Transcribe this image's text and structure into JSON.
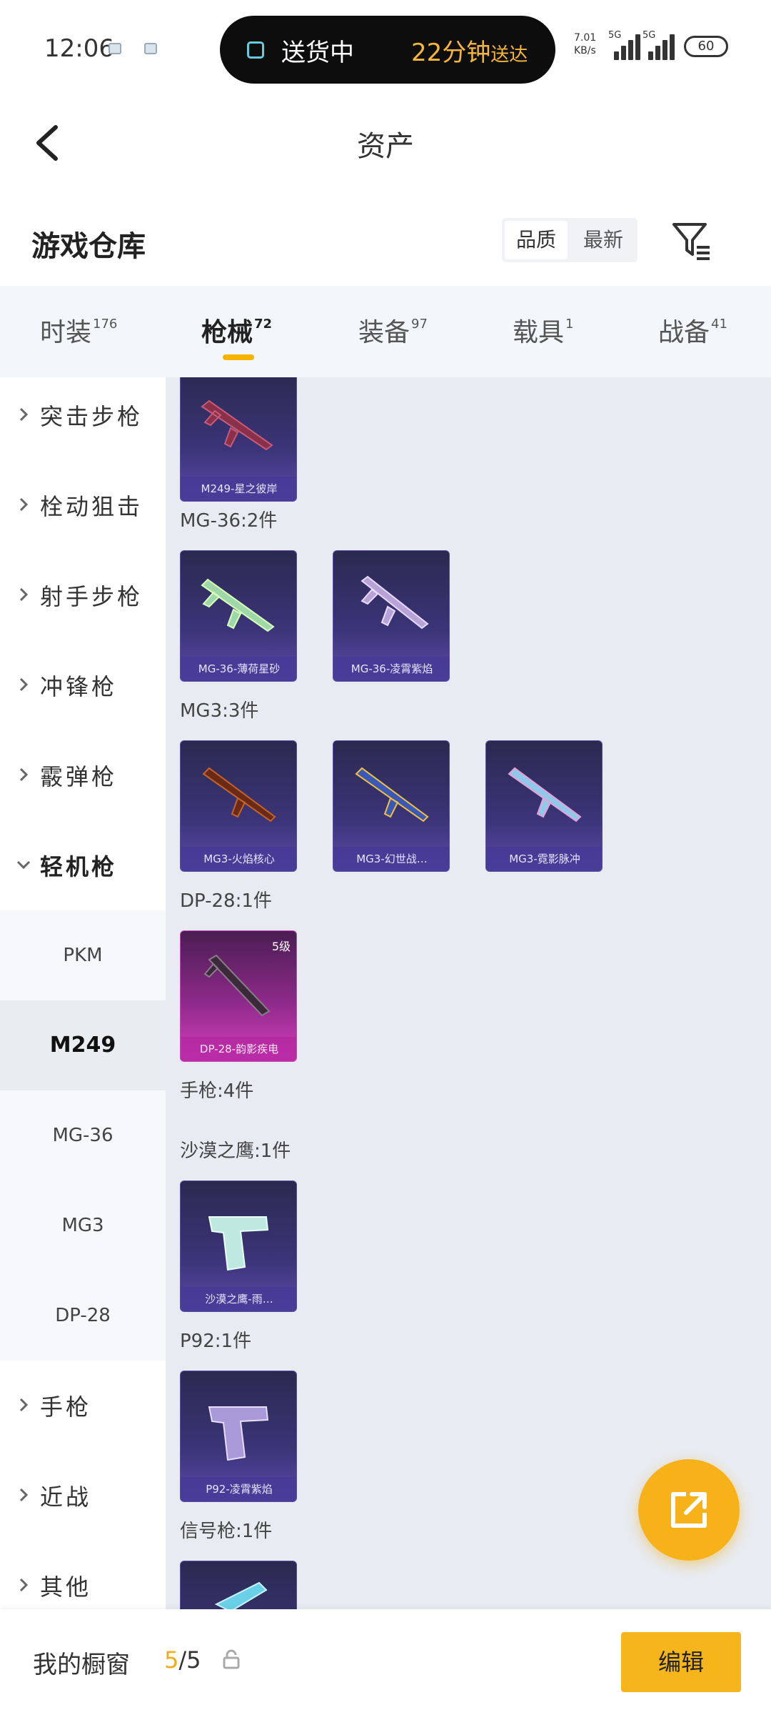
{
  "status_bar": {
    "time": "12:06",
    "pill_left": "送货中",
    "pill_right_time": "22分钟",
    "pill_right_suffix": "送达",
    "speed_value": "7.01",
    "speed_unit": "KB/s",
    "sig1_label": "5G",
    "sig2_label": "5G",
    "battery": "60"
  },
  "topbar": {
    "title": "资产",
    "back_icon": "chevron-left-icon"
  },
  "header": {
    "section_title": "游戏仓库",
    "sort_options": [
      "品质",
      "最新"
    ],
    "sort_selected": "品质",
    "filter_icon": "filter-icon"
  },
  "tabs": [
    {
      "label": "时装",
      "count": "176"
    },
    {
      "label": "枪械",
      "count": "72",
      "active": true
    },
    {
      "label": "装备",
      "count": "97"
    },
    {
      "label": "载具",
      "count": "1"
    },
    {
      "label": "战备",
      "count": "41"
    }
  ],
  "sidebar": {
    "items": [
      {
        "label": "突击步枪"
      },
      {
        "label": "栓动狙击"
      },
      {
        "label": "射手步枪"
      },
      {
        "label": "冲锋枪"
      },
      {
        "label": "霰弹枪"
      },
      {
        "label": "轻机枪",
        "expanded": true
      }
    ],
    "sub_items": [
      {
        "label": "PKM"
      },
      {
        "label": "M249",
        "selected": true
      },
      {
        "label": "MG-36"
      },
      {
        "label": "MG3"
      },
      {
        "label": "DP-28"
      }
    ],
    "items_after": [
      {
        "label": "手枪"
      },
      {
        "label": "近战"
      },
      {
        "label": "其他"
      }
    ]
  },
  "content": {
    "groups": [
      {
        "label": "MG-36:2件"
      },
      {
        "label": "MG3:3件"
      },
      {
        "label": "DP-28:1件"
      },
      {
        "label": "手枪:4件"
      },
      {
        "label": "沙漠之鹰:1件"
      },
      {
        "label": "P92:1件"
      },
      {
        "label": "信号枪:1件"
      }
    ],
    "cards": [
      {
        "name": "M249-星之彼岸"
      },
      {
        "name": "MG-36-薄荷星砂"
      },
      {
        "name": "MG-36-凌霄紫焰"
      },
      {
        "name": "MG3-火焰核心"
      },
      {
        "name": "MG3-幻世战…"
      },
      {
        "name": "MG3-霓影脉冲"
      },
      {
        "name": "DP-28-韵影疾电",
        "level": "5级"
      },
      {
        "name": "沙漠之鹰-雨…"
      },
      {
        "name": "P92-凌霄紫焰"
      },
      {
        "name": ""
      }
    ]
  },
  "fab": {
    "icon": "share-external-icon"
  },
  "bottom_bar": {
    "label": "我的橱窗",
    "count_used": "5",
    "count_total": "/5",
    "lock_icon": "lock-icon",
    "edit_label": "编辑"
  },
  "colors": {
    "accent": "#f6b51b",
    "card_purple": "#3b3478",
    "card_pink": "#d53fbf"
  }
}
